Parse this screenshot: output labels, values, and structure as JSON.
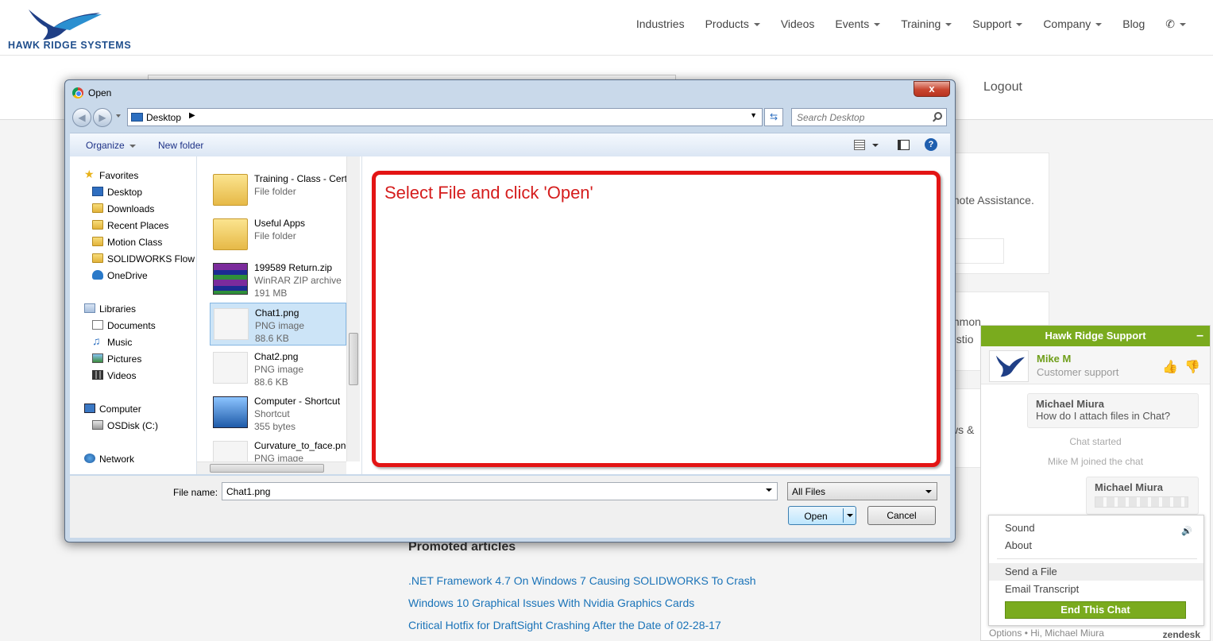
{
  "site": {
    "logo_text": "HAWK RIDGE SYSTEMS",
    "nav": [
      {
        "label": "Industries",
        "caret": false
      },
      {
        "label": "Products",
        "caret": true
      },
      {
        "label": "Videos",
        "caret": false
      },
      {
        "label": "Events",
        "caret": true
      },
      {
        "label": "Training",
        "caret": true
      },
      {
        "label": "Support",
        "caret": true
      },
      {
        "label": "Company",
        "caret": true
      },
      {
        "label": "Blog",
        "caret": false
      }
    ],
    "phone_icon": "phone-icon",
    "logout": "Logout",
    "background_fragments": [
      "mote Assistance.",
      "mmon",
      "estio",
      "ws &"
    ],
    "promoted_title": "Promoted articles",
    "articles": [
      ".NET Framework 4.7 On Windows 7 Causing SOLIDWORKS To Crash",
      "Windows 10 Graphical Issues With Nvidia Graphics Cards",
      "Critical Hotfix for DraftSight Crashing After the Date of 02-28-17"
    ]
  },
  "dialog": {
    "title": "Open",
    "close_label": "x",
    "address": "Desktop",
    "search_placeholder": "Search Desktop",
    "toolbar": {
      "organize": "Organize",
      "new_folder": "New folder",
      "help": "?"
    },
    "nav_tree": [
      {
        "label": "Favorites",
        "icon": "star-icon",
        "level": 0
      },
      {
        "label": "Desktop",
        "icon": "desktop-icon",
        "level": 1
      },
      {
        "label": "Downloads",
        "icon": "folder-icon",
        "level": 1
      },
      {
        "label": "Recent Places",
        "icon": "folder-icon",
        "level": 1
      },
      {
        "label": "Motion Class",
        "icon": "folder-icon",
        "level": 1
      },
      {
        "label": "SOLIDWORKS Flow S",
        "icon": "folder-icon",
        "level": 1
      },
      {
        "label": "OneDrive",
        "icon": "cloud-icon",
        "level": 1
      },
      {
        "label": "Libraries",
        "icon": "library-icon",
        "level": 0
      },
      {
        "label": "Documents",
        "icon": "document-icon",
        "level": 1
      },
      {
        "label": "Music",
        "icon": "music-icon",
        "level": 1
      },
      {
        "label": "Pictures",
        "icon": "picture-icon",
        "level": 1
      },
      {
        "label": "Videos",
        "icon": "video-icon",
        "level": 1
      },
      {
        "label": "Computer",
        "icon": "computer-icon",
        "level": 0
      },
      {
        "label": "OSDisk (C:)",
        "icon": "disk-icon",
        "level": 1
      },
      {
        "label": "Network",
        "icon": "network-icon",
        "level": 0
      }
    ],
    "files": [
      {
        "name": "Training - Class - Cert",
        "type": "File folder",
        "size": "",
        "icon": "folder-icon",
        "selected": false
      },
      {
        "name": "Useful Apps",
        "type": "File folder",
        "size": "",
        "icon": "folder-icon",
        "selected": false
      },
      {
        "name": "199589 Return.zip",
        "type": "WinRAR ZIP archive",
        "size": "191 MB",
        "icon": "zip-icon",
        "selected": false
      },
      {
        "name": "Chat1.png",
        "type": "PNG image",
        "size": "88.6 KB",
        "icon": "png-icon",
        "selected": true
      },
      {
        "name": "Chat2.png",
        "type": "PNG image",
        "size": "88.6 KB",
        "icon": "png-icon",
        "selected": false
      },
      {
        "name": "Computer - Shortcut",
        "type": "Shortcut",
        "size": "355 bytes",
        "icon": "computer-icon",
        "selected": false
      },
      {
        "name": "Curvature_to_face.png",
        "type": "PNG image",
        "size": "",
        "icon": "png-icon",
        "selected": false
      }
    ],
    "annotation": "Select File and click 'Open'",
    "file_name_label": "File name:",
    "file_name_value": "Chat1.png",
    "file_type_filter": "All Files",
    "open_label": "Open",
    "cancel_label": "Cancel"
  },
  "chat": {
    "header": "Hawk Ridge Support",
    "minimize": "–",
    "agent_name": "Mike M",
    "agent_role": "Customer support",
    "messages": [
      {
        "name": "Michael Miura",
        "text": "How do I attach files in Chat?"
      }
    ],
    "events": [
      "Chat started",
      "Mike M joined the chat"
    ],
    "second_sender": "Michael Miura",
    "menu": {
      "sound": "Sound",
      "about": "About",
      "send_file": "Send a File",
      "email_transcript": "Email Transcript",
      "end_chat": "End This Chat"
    },
    "footer_options": "Options",
    "footer_user": "Hi, Michael Miura",
    "brand": "zendesk",
    "accent_color": "#7aab1e"
  }
}
